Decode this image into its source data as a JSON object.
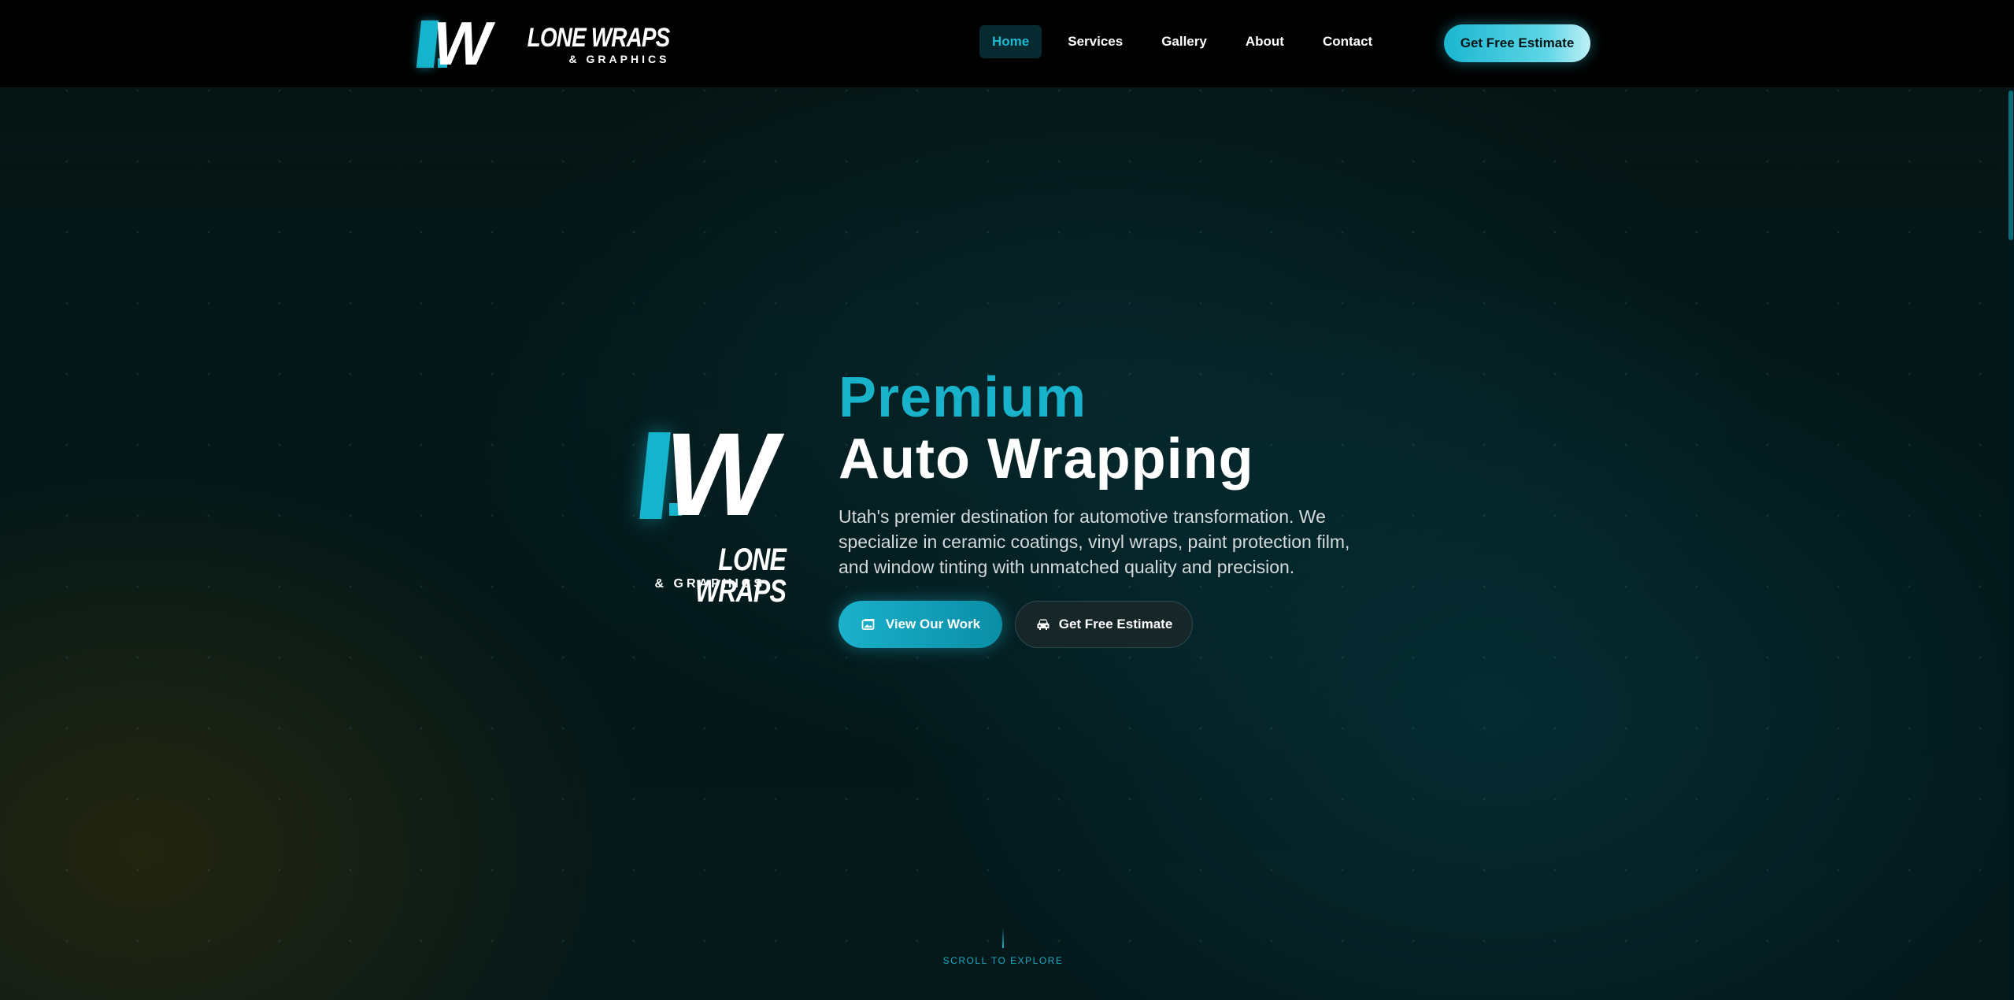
{
  "brand": {
    "name": "LONE WRAPS",
    "subtitle": "& GRAPHICS",
    "accent_color": "#18b2cb"
  },
  "nav": {
    "items": [
      {
        "label": "Home",
        "active": true
      },
      {
        "label": "Services",
        "active": false
      },
      {
        "label": "Gallery",
        "active": false
      },
      {
        "label": "About",
        "active": false
      },
      {
        "label": "Contact",
        "active": false
      }
    ],
    "cta_label": "Get Free Estimate"
  },
  "hero": {
    "logo_name": "LONE WRAPS",
    "logo_subtitle": "& GRAPHICS",
    "headline_accent": "Premium",
    "headline_main": "Auto Wrapping",
    "description": "Utah's premier destination for automotive transformation. We specialize in ceramic coatings, vinyl wraps, paint protection film, and window tinting with unmatched quality and precision.",
    "primary_button": {
      "label": "View Our Work",
      "icon": "gallery-icon"
    },
    "secondary_button": {
      "label": "Get Free Estimate",
      "icon": "car-icon"
    },
    "scroll_hint": "SCROLL TO EXPLORE"
  }
}
